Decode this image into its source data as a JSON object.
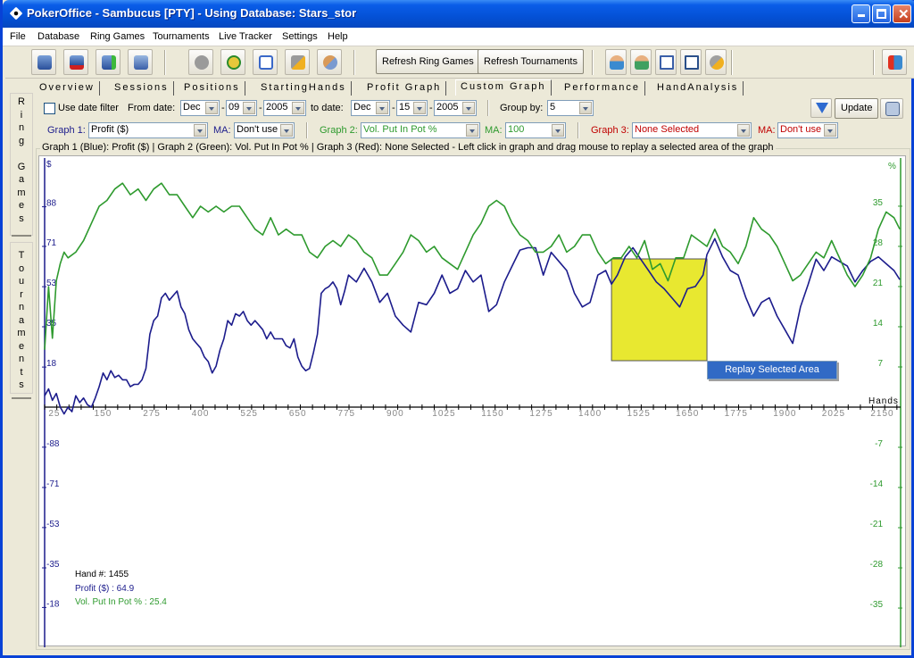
{
  "window": {
    "title": "PokerOffice - Sambucus [PTY] - Using Database: Stars_stor",
    "controls": [
      "minimize",
      "maximize",
      "close"
    ]
  },
  "menu": [
    "File",
    "Database",
    "Ring Games",
    "Tournaments",
    "Live Tracker",
    "Settings",
    "Help"
  ],
  "toolbar": {
    "icons_left": [
      "save-database-icon",
      "delete-database-icon",
      "add-database-icon",
      "check-database-icon",
      "settings-gear-icon",
      "clock-refresh-icon",
      "export-document-icon",
      "tools-icon",
      "player-search-icon"
    ],
    "refresh_ring": "Refresh Ring Games",
    "refresh_tournaments": "Refresh Tournaments",
    "icons_right": [
      "player-icon",
      "players-icon",
      "table-grid-icon",
      "table-color-icon",
      "preferences-icon"
    ],
    "exit_icon": "exit-door-icon"
  },
  "side_tabs": {
    "ring": "Ring Games",
    "tournaments": "Tournaments"
  },
  "tabs": [
    {
      "label": "Overview",
      "active": false
    },
    {
      "label": "Sessions",
      "active": false
    },
    {
      "label": "Positions",
      "active": false
    },
    {
      "label": "StartingHands",
      "active": false
    },
    {
      "label": "Profit Graph",
      "active": false
    },
    {
      "label": "Custom Graph",
      "active": true
    },
    {
      "label": "Performance",
      "active": false
    },
    {
      "label": "HandAnalysis",
      "active": false
    }
  ],
  "filters": {
    "use_date_filter": "Use date filter",
    "use_date_checked": false,
    "from_label": "From date:",
    "from_month": "Dec",
    "from_day": "09",
    "from_year": "2005",
    "to_label": "to date:",
    "to_month": "Dec",
    "to_day": "15",
    "to_year": "2005",
    "group_by_label": "Group by:",
    "group_by": "5",
    "update": "Update"
  },
  "graph_select": {
    "g1_label": "Graph 1:",
    "g1_value": "Profit ($)",
    "g1_ma_label": "MA:",
    "g1_ma": "Don't use",
    "g2_label": "Graph 2:",
    "g2_value": "Vol. Put In Pot %",
    "g2_ma_label": "MA:",
    "g2_ma": "100",
    "g3_label": "Graph 3:",
    "g3_value": "None Selected",
    "g3_ma_label": "MA:",
    "g3_ma": "Don't use"
  },
  "group_title": "Graph 1 (Blue): Profit ($) | Graph 2 (Green): Vol. Put In Pot % | Graph 3 (Red): None Selected  - Left click in graph and drag mouse to replay a selected area of the graph",
  "context_menu": "Replay Selected Area",
  "readout": {
    "hand": "Hand #: 1455",
    "profit": "Profit ($) : 64.9",
    "vpip": "Vol. Put In Pot % : 25.4"
  },
  "colors": {
    "blue_series": "#1c1c8c",
    "green_series": "#2e9a2e",
    "red_label": "#c00000",
    "selection": "#e8e830"
  },
  "chart_data": {
    "type": "line",
    "title": "",
    "xlabel": "Hands",
    "ylabel_left": "$",
    "ylabel_right": "%",
    "x_ticks": [
      25,
      150,
      275,
      400,
      525,
      650,
      775,
      900,
      1025,
      1150,
      1275,
      1400,
      1525,
      1650,
      1775,
      1900,
      2025,
      2150
    ],
    "y_left_ticks": [
      88,
      71,
      53,
      35,
      18,
      -18,
      -35,
      -53,
      -71,
      -88
    ],
    "y_right_ticks": [
      35,
      28,
      21,
      14,
      7,
      -7,
      -14,
      -21,
      -28,
      -35
    ],
    "xlim": [
      0,
      2195
    ],
    "ylim_left": [
      -108,
      108
    ],
    "ylim_right": [
      -43,
      43
    ],
    "selection_range_hands": [
      1455,
      1700
    ],
    "series": [
      {
        "name": "Profit ($)",
        "axis": "left",
        "color": "blue",
        "x": [
          0,
          10,
          20,
          30,
          40,
          50,
          60,
          70,
          80,
          90,
          100,
          110,
          120,
          130,
          140,
          150,
          160,
          170,
          180,
          190,
          200,
          210,
          220,
          230,
          240,
          250,
          260,
          270,
          280,
          290,
          300,
          310,
          320,
          330,
          340,
          350,
          360,
          370,
          380,
          390,
          400,
          410,
          420,
          430,
          440,
          450,
          460,
          470,
          480,
          490,
          500,
          510,
          520,
          530,
          540,
          550,
          560,
          570,
          580,
          590,
          600,
          610,
          620,
          630,
          640,
          650,
          660,
          670,
          680,
          690,
          700,
          710,
          720,
          730,
          740,
          750,
          760,
          770,
          780,
          800,
          820,
          840,
          860,
          880,
          900,
          920,
          940,
          960,
          980,
          1000,
          1020,
          1040,
          1060,
          1080,
          1100,
          1120,
          1140,
          1160,
          1180,
          1200,
          1220,
          1240,
          1260,
          1280,
          1300,
          1320,
          1340,
          1360,
          1380,
          1400,
          1420,
          1440,
          1455,
          1470,
          1490,
          1510,
          1530,
          1550,
          1570,
          1590,
          1610,
          1630,
          1650,
          1670,
          1690,
          1700,
          1720,
          1740,
          1760,
          1780,
          1800,
          1820,
          1840,
          1860,
          1880,
          1900,
          1920,
          1940,
          1960,
          1980,
          2000,
          2020,
          2040,
          2060,
          2080,
          2100,
          2120,
          2140,
          2160,
          2180,
          2195
        ],
        "values": [
          5,
          8,
          3,
          6,
          0,
          -3,
          0,
          -2,
          5,
          2,
          4,
          1,
          0,
          4,
          9,
          15,
          12,
          16,
          13,
          14,
          12,
          12,
          9,
          10,
          10,
          12,
          17,
          32,
          38,
          40,
          48,
          50,
          47,
          49,
          51,
          44,
          41,
          34,
          30,
          28,
          26,
          22,
          20,
          15,
          18,
          25,
          30,
          38,
          36,
          41,
          40,
          42,
          38,
          36,
          38,
          36,
          34,
          30,
          33,
          30,
          30,
          30,
          27,
          26,
          30,
          22,
          18,
          16,
          17,
          24,
          32,
          50,
          52,
          53,
          55,
          52,
          45,
          51,
          58,
          55,
          61,
          55,
          46,
          50,
          40,
          36,
          33,
          46,
          45,
          50,
          58,
          50,
          52,
          60,
          55,
          58,
          42,
          45,
          55,
          62,
          69,
          70,
          70,
          58,
          68,
          64,
          60,
          50,
          44,
          46,
          58,
          60,
          54,
          58,
          66,
          70,
          65,
          60,
          55,
          52,
          48,
          44,
          52,
          53,
          58,
          67,
          74,
          66,
          60,
          58,
          48,
          40,
          46,
          48,
          40,
          34,
          28,
          44,
          54,
          65,
          60,
          66,
          64,
          62,
          55,
          60,
          64,
          66,
          63,
          60,
          56,
          48,
          45,
          50,
          44,
          37,
          30,
          23,
          22,
          21,
          19,
          14,
          10,
          8,
          11,
          10,
          7,
          5,
          4,
          -2,
          -6,
          3,
          1,
          -2,
          -4,
          3,
          5,
          10,
          16,
          30,
          32,
          38,
          40,
          45,
          50,
          44,
          38,
          34,
          30,
          28,
          34,
          37,
          31,
          35,
          46,
          48,
          45,
          51,
          46
        ]
      },
      {
        "name": "Vol. Put In Pot %",
        "axis": "right",
        "color": "green",
        "x": [
          0,
          10,
          20,
          30,
          40,
          50,
          60,
          80,
          100,
          120,
          140,
          160,
          180,
          200,
          220,
          240,
          260,
          280,
          300,
          320,
          340,
          360,
          380,
          400,
          420,
          440,
          460,
          480,
          500,
          520,
          540,
          560,
          580,
          600,
          620,
          640,
          660,
          680,
          700,
          720,
          740,
          760,
          780,
          800,
          820,
          840,
          860,
          880,
          900,
          920,
          940,
          960,
          980,
          1000,
          1020,
          1040,
          1060,
          1080,
          1100,
          1120,
          1140,
          1160,
          1180,
          1200,
          1220,
          1240,
          1260,
          1280,
          1300,
          1320,
          1340,
          1360,
          1380,
          1400,
          1420,
          1440,
          1460,
          1480,
          1500,
          1520,
          1540,
          1560,
          1580,
          1600,
          1620,
          1640,
          1660,
          1680,
          1700,
          1720,
          1740,
          1760,
          1780,
          1800,
          1820,
          1840,
          1860,
          1880,
          1900,
          1920,
          1940,
          1960,
          1980,
          2000,
          2020,
          2040,
          2060,
          2080,
          2100,
          2120,
          2140,
          2160,
          2180,
          2195
        ],
        "values": [
          10,
          21,
          12,
          22,
          25,
          27,
          26,
          27,
          29,
          32,
          35,
          36,
          38,
          39,
          37,
          38,
          36,
          38,
          39,
          37,
          37,
          35,
          33,
          35,
          34,
          35,
          34,
          35,
          35,
          33,
          31,
          30,
          33,
          30,
          31,
          30,
          30,
          27,
          26,
          28,
          29,
          28,
          30,
          29,
          27,
          26,
          23,
          23,
          25,
          27,
          30,
          29,
          27,
          28,
          26,
          25,
          24,
          27,
          30,
          32,
          35,
          36,
          35,
          32,
          30,
          29,
          27,
          27,
          28,
          30,
          27,
          28,
          30,
          30,
          27,
          25,
          26,
          26,
          28,
          26,
          29,
          24,
          25,
          22,
          26,
          26,
          30,
          29,
          28,
          31,
          28,
          27,
          25,
          28,
          33,
          31,
          30,
          28,
          25,
          22,
          23,
          25,
          27,
          26,
          29,
          26,
          23,
          21,
          23,
          26,
          31,
          34,
          33,
          31,
          33,
          33,
          34,
          33,
          35,
          33,
          30,
          25
        ]
      }
    ]
  }
}
